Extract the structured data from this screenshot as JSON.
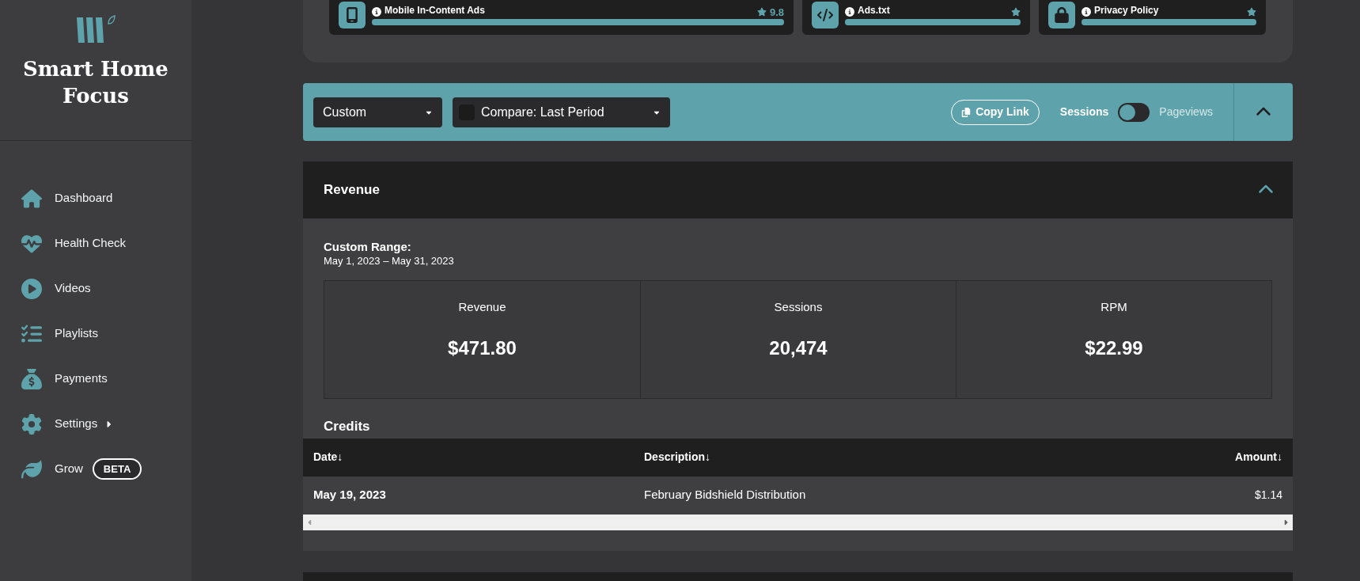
{
  "sidebar": {
    "brand": "Smart Home Focus",
    "items": [
      {
        "label": "Dashboard",
        "kind": "plain"
      },
      {
        "label": "Health Check",
        "kind": "plain"
      },
      {
        "label": "Videos",
        "kind": "plain"
      },
      {
        "label": "Playlists",
        "kind": "plain"
      },
      {
        "label": "Payments",
        "kind": "plain"
      },
      {
        "label": "Settings",
        "kind": "submenu"
      },
      {
        "label": "Grow",
        "kind": "badge",
        "badge": "BETA"
      }
    ]
  },
  "health_cards": [
    {
      "title": "Mobile In-Content Ads",
      "score": "9.8",
      "level": 1
    },
    {
      "title": "Ads.txt",
      "level": 1
    },
    {
      "title": "Privacy Policy",
      "level": 1
    }
  ],
  "filter_bar": {
    "range": "Custom",
    "compare": {
      "label": "Compare: Last Period",
      "checked": false
    },
    "copy_link": "Copy Link",
    "metric_toggle": [
      {
        "label": "Sessions",
        "selected": true
      },
      {
        "label": "Pageviews",
        "selected": false
      }
    ],
    "expanded": true
  },
  "revenue": {
    "title": "Revenue",
    "expanded": true,
    "range_label": "Custom Range:",
    "range": "May 1, 2023 – May 31, 2023",
    "stats": [
      {
        "label": "Revenue",
        "value": "$471.80"
      },
      {
        "label": "Sessions",
        "value": "20,474"
      },
      {
        "label": "RPM",
        "value": "$22.99"
      }
    ],
    "credits": {
      "title": "Credits",
      "columns": [
        "Date↓",
        "Description↓",
        "Amount↓"
      ],
      "rows": [
        {
          "date": "May 19, 2023",
          "description": "February Bidshield Distribution",
          "amount": "$1.14"
        }
      ]
    }
  }
}
